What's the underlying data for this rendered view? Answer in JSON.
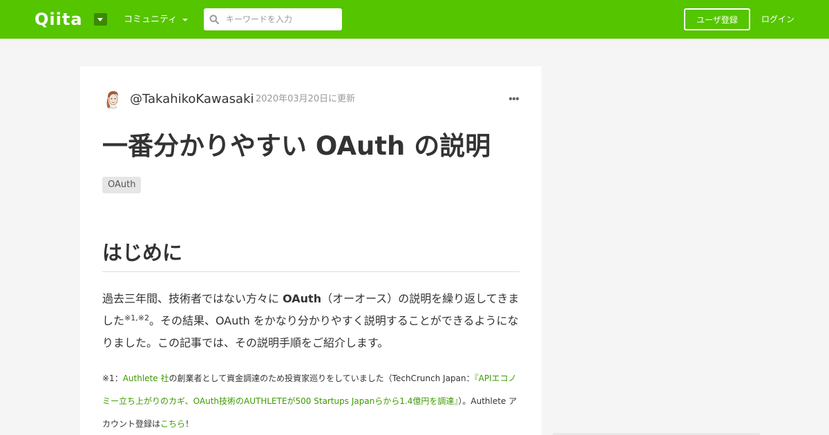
{
  "header": {
    "logo": "Qiita",
    "community_label": "コミュニティ",
    "search_placeholder": "キーワードを入力",
    "signup_label": "ユーザ登録",
    "login_label": "ログイン"
  },
  "article": {
    "author": "@TakahikoKawasaki",
    "updated": "2020年03月20日に更新",
    "title": "一番分かりやすい OAuth の説明",
    "tags": [
      "OAuth"
    ],
    "section_heading": "はじめに",
    "intro": {
      "part1": "過去三年間、技術者ではない方々に ",
      "bold": "OAuth",
      "part2": "（オーオース）の説明を繰り返してきました",
      "sup": "※1,※2",
      "part3": "。その結果、OAuth をかなり分かりやすく説明することができるようになりました。この記事では、その説明手順をご紹介します。"
    },
    "footnote": {
      "prefix": "※1：",
      "link1": "Authlete 社",
      "text1": "の創業者として資金調達のため投資家巡りをしていました（TechCrunch Japan：",
      "link2": "『APIエコノミー立ち上がりのカギ、OAuth技術のAUTHLETEが500 Startups Japanらから1.4億円を調達』",
      "text2": "）。Authlete アカウント登録は",
      "link3": "こちら",
      "suffix": "！"
    }
  },
  "colors": {
    "brand": "#55c500",
    "link": "#3d9a00",
    "text": "#333333",
    "muted": "#999999"
  },
  "icons": [
    "search-icon",
    "chevron-down-icon",
    "more-horizontal-icon",
    "avatar"
  ]
}
